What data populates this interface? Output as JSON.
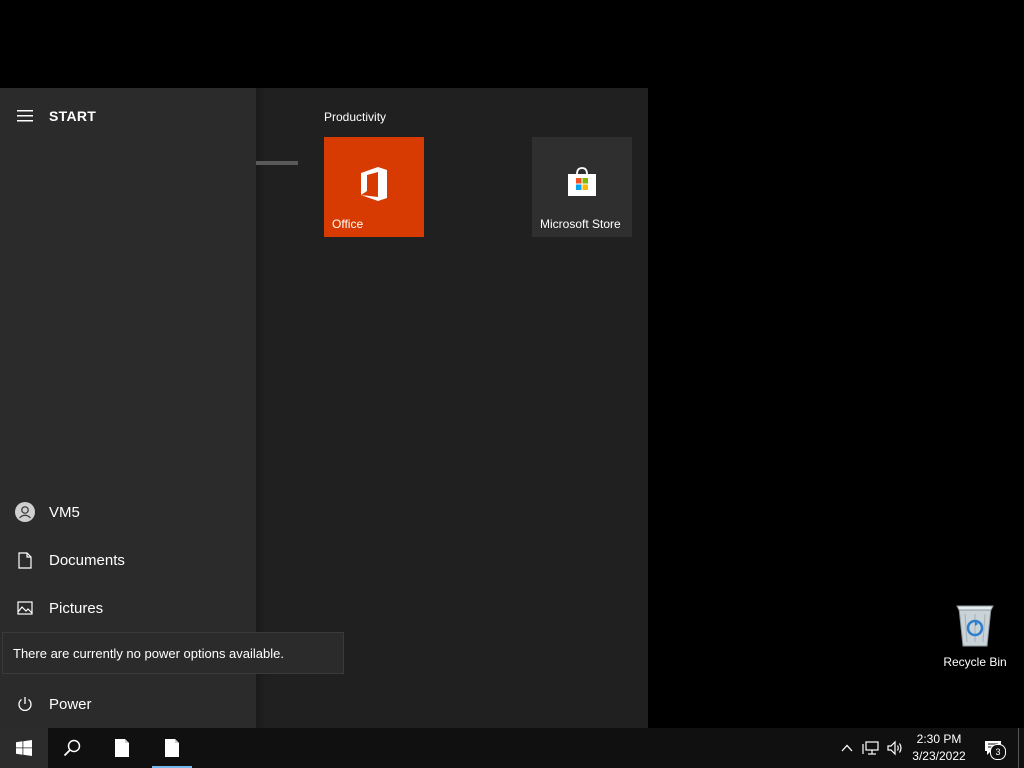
{
  "start_menu": {
    "title": "START",
    "rail": {
      "user": "VM5",
      "documents": "Documents",
      "pictures": "Pictures",
      "power": "Power"
    },
    "tooltip": "There are currently no power options available.",
    "groups": [
      {
        "title": "Productivity",
        "tiles": [
          {
            "label": "Office",
            "color": "#d83b01"
          },
          {
            "label": "Microsoft Store",
            "color": "#2f2f2f"
          }
        ]
      }
    ]
  },
  "desktop": {
    "icons": [
      {
        "label": "Recycle Bin"
      }
    ]
  },
  "taskbar": {
    "time": "2:30 PM",
    "date": "3/23/2022",
    "notification_count": "3",
    "accent": "#76b9ed"
  }
}
